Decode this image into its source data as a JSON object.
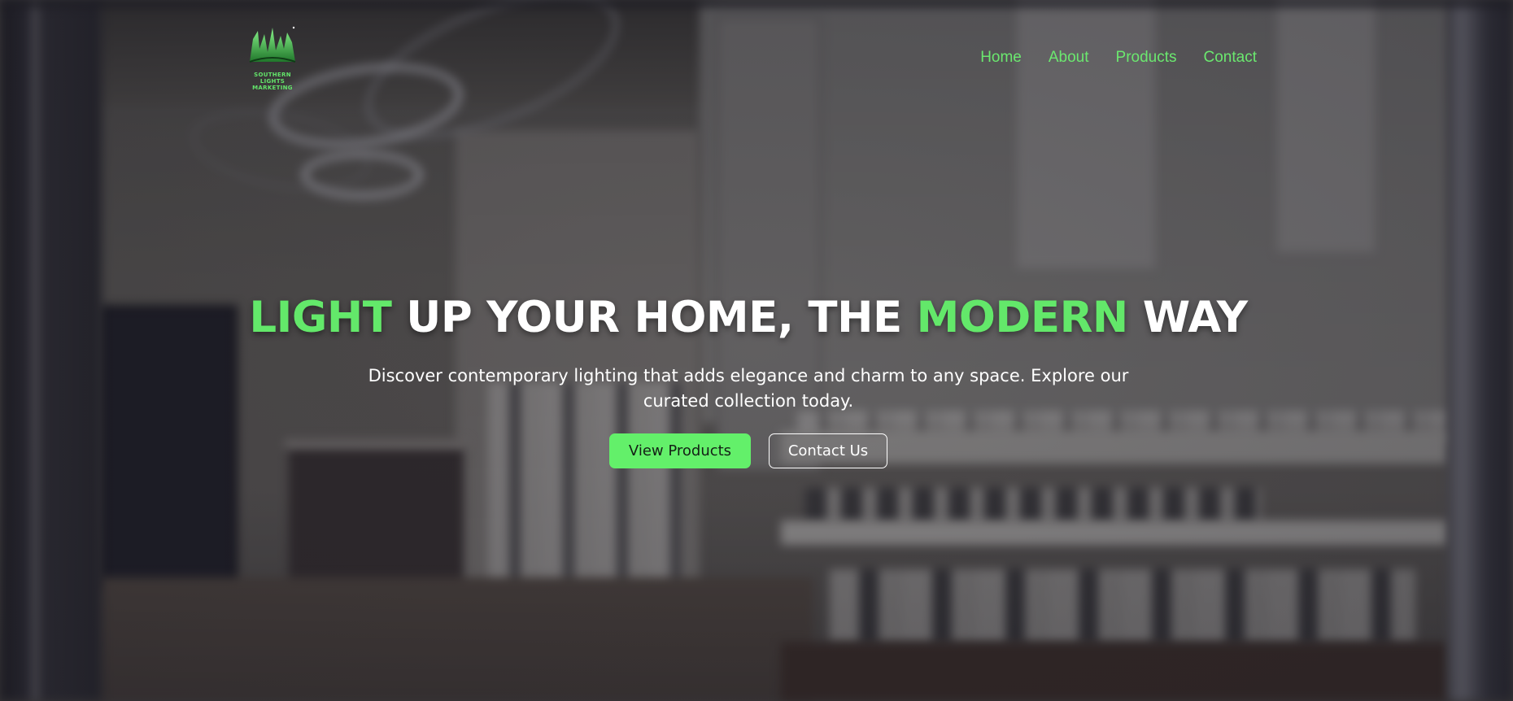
{
  "brand": {
    "logo_icon": "aurora-lights-logo-icon",
    "name": "SOUTHERN LIGHTS\nMARKETING",
    "accent_color": "#63e86a"
  },
  "nav": {
    "items": [
      {
        "label": "Home"
      },
      {
        "label": "About"
      },
      {
        "label": "Products"
      },
      {
        "label": "Contact"
      }
    ]
  },
  "hero": {
    "headline": {
      "part1": "LIGHT",
      "part2": " UP YOUR HOME, THE ",
      "part3": "MODERN",
      "part4": " WAY"
    },
    "subtitle": "Discover contemporary lighting that adds elegance and charm to any space. Explore our curated collection today.",
    "primary_button": "View Products",
    "secondary_button": "Contact Us",
    "background": "blurred-showroom-photo"
  },
  "colors": {
    "accent": "#63e86a",
    "primary_button_bg": "#63f06a",
    "text": "#ffffff"
  }
}
